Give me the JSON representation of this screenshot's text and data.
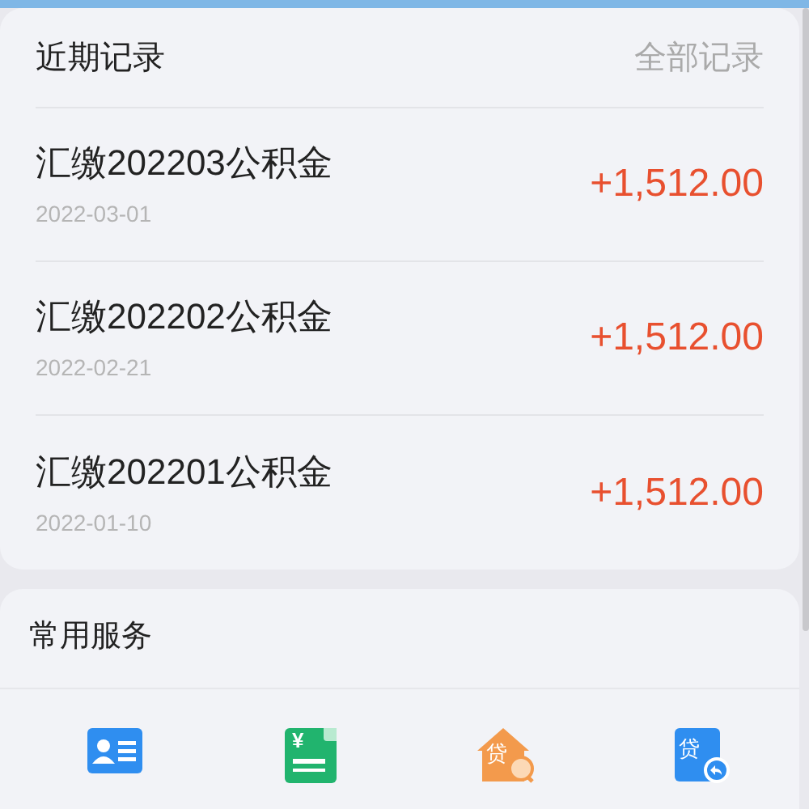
{
  "records": {
    "title": "近期记录",
    "all_link": "全部记录",
    "items": [
      {
        "name": "汇缴202203公积金",
        "date": "2022-03-01",
        "amount": "+1,512.00"
      },
      {
        "name": "汇缴202202公积金",
        "date": "2022-02-21",
        "amount": "+1,512.00"
      },
      {
        "name": "汇缴202201公积金",
        "date": "2022-01-10",
        "amount": "+1,512.00"
      }
    ]
  },
  "services": {
    "title": "常用服务",
    "items": [
      {
        "kind": "card"
      },
      {
        "kind": "bill",
        "glyph": "¥"
      },
      {
        "kind": "house",
        "glyph": "贷"
      },
      {
        "kind": "loan",
        "glyph": "贷"
      }
    ]
  }
}
